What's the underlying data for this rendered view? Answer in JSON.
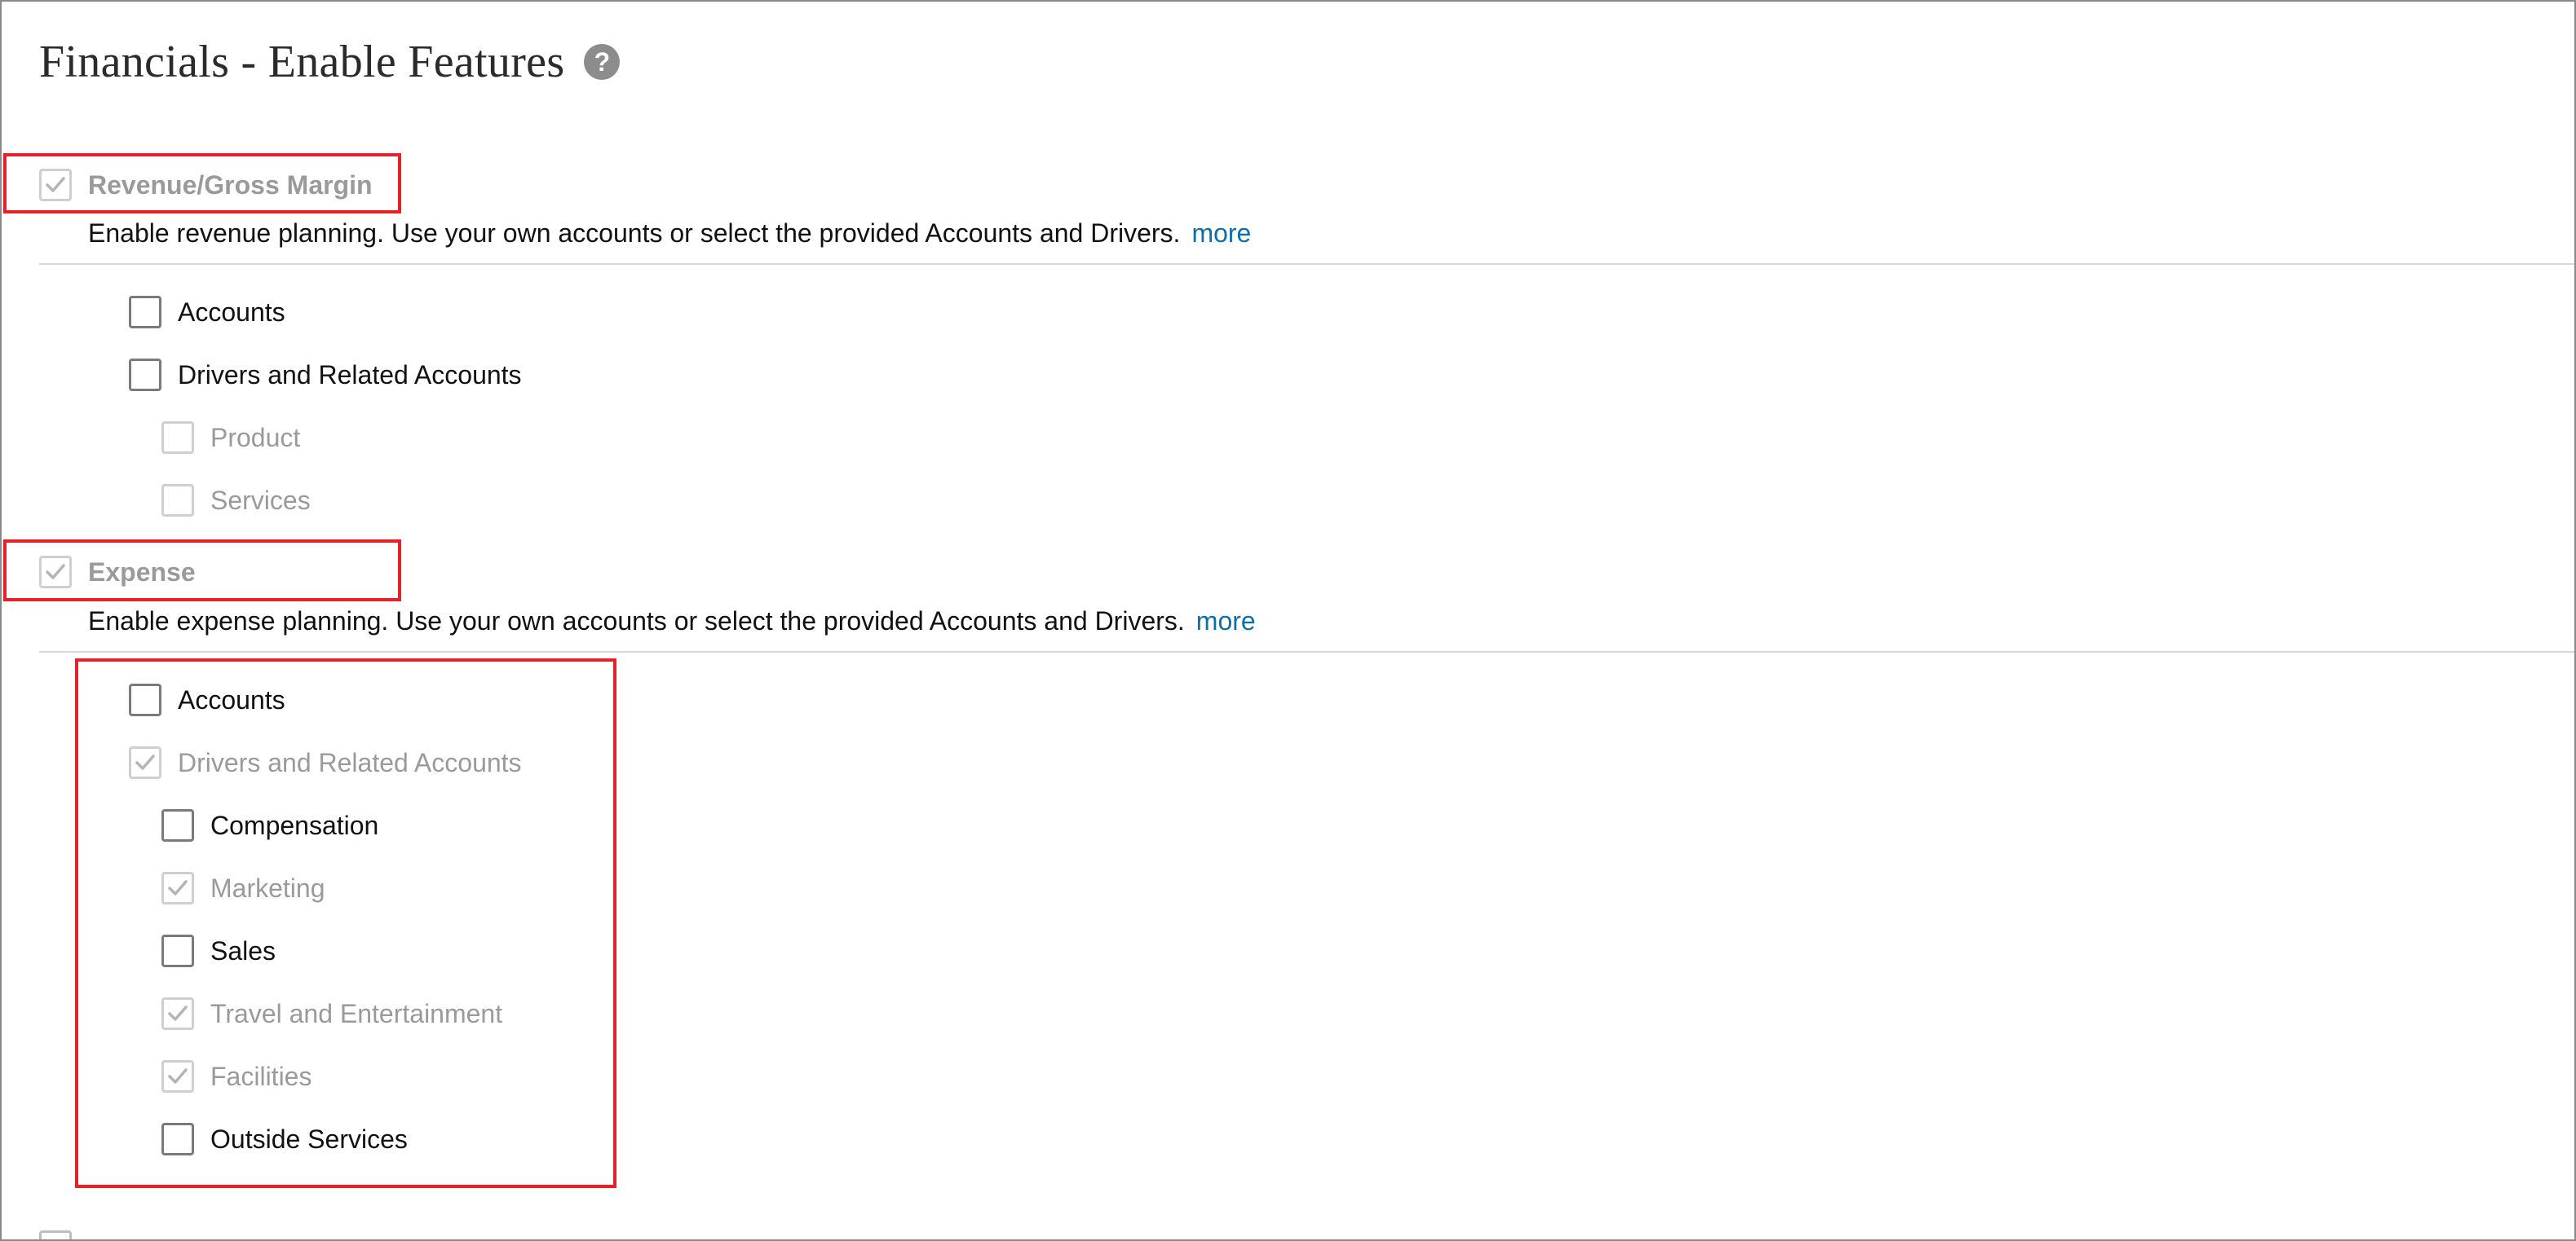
{
  "page": {
    "title": "Financials - Enable Features",
    "help_icon": "help-icon",
    "help_glyph": "?"
  },
  "sections": {
    "revenue": {
      "label": "Revenue/Gross Margin",
      "checked": true,
      "disabled": true,
      "description": "Enable revenue planning. Use your own accounts or select the provided Accounts and Drivers.",
      "more_label": "more",
      "options": {
        "accounts": {
          "label": "Accounts",
          "checked": false,
          "disabled": false
        },
        "drivers": {
          "label": "Drivers and Related Accounts",
          "checked": false,
          "disabled": false
        },
        "product": {
          "label": "Product",
          "checked": false,
          "disabled": true
        },
        "services": {
          "label": "Services",
          "checked": false,
          "disabled": true
        }
      }
    },
    "expense": {
      "label": "Expense",
      "checked": true,
      "disabled": true,
      "description": "Enable expense planning. Use your own accounts or select the provided Accounts and Drivers.",
      "more_label": "more",
      "options": {
        "accounts": {
          "label": "Accounts",
          "checked": false,
          "disabled": false
        },
        "drivers": {
          "label": "Drivers and Related Accounts",
          "checked": true,
          "disabled": true
        },
        "compensation": {
          "label": "Compensation",
          "checked": false,
          "disabled": false
        },
        "marketing": {
          "label": "Marketing",
          "checked": true,
          "disabled": true
        },
        "sales": {
          "label": "Sales",
          "checked": false,
          "disabled": false
        },
        "travel": {
          "label": "Travel and Entertainment",
          "checked": true,
          "disabled": true
        },
        "facilities": {
          "label": "Facilities",
          "checked": true,
          "disabled": true
        },
        "outside_services": {
          "label": "Outside Services",
          "checked": false,
          "disabled": false
        }
      }
    }
  },
  "colors": {
    "highlight": "#e8202a",
    "link": "#0e6fa8",
    "muted_text": "#9a9a9a",
    "checkmark": "#b5b5b5"
  }
}
